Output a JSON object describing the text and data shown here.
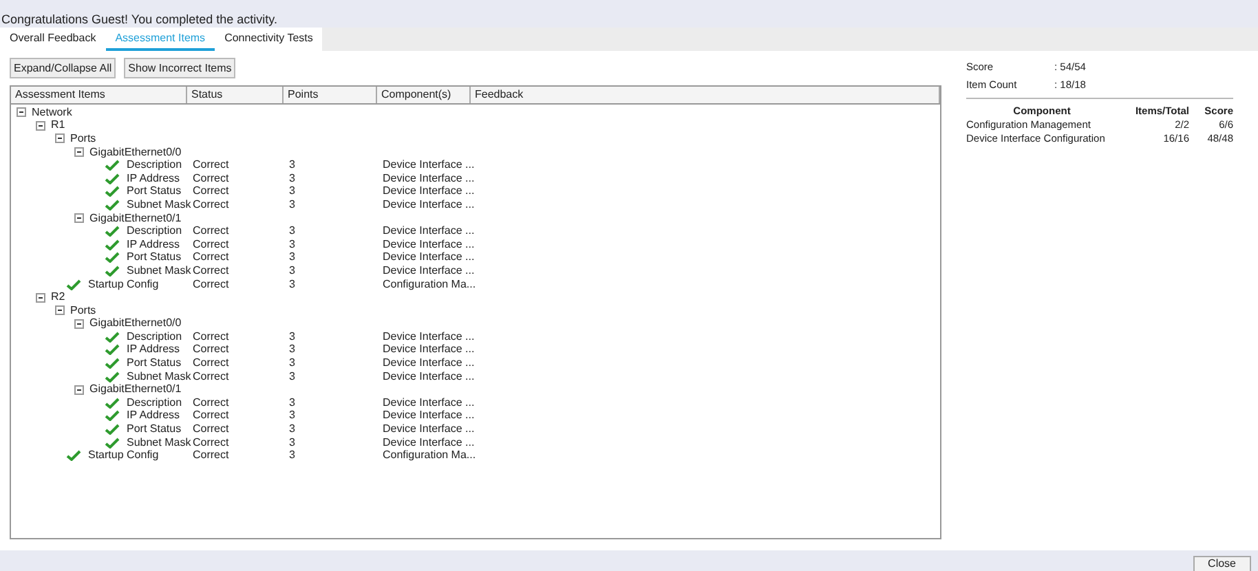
{
  "banner": "Congratulations Guest! You completed the activity.",
  "tabs": [
    {
      "label": "Overall Feedback",
      "selected": false
    },
    {
      "label": "Assessment Items",
      "selected": true
    },
    {
      "label": "Connectivity Tests",
      "selected": false
    }
  ],
  "toolbar": [
    "Expand/Collapse All",
    "Show Incorrect Items"
  ],
  "table": {
    "columns": [
      "Assessment Items",
      "Status",
      "Points",
      "Component(s)",
      "Feedback"
    ],
    "tree": [
      {
        "kind": "group",
        "label": "Network",
        "expanded": true,
        "children": [
          {
            "kind": "group",
            "label": "R1",
            "expanded": true,
            "children": [
              {
                "kind": "group",
                "label": "Ports",
                "expanded": true,
                "children": [
                  {
                    "kind": "group",
                    "label": "GigabitEthernet0/0",
                    "expanded": true,
                    "children": [
                      {
                        "kind": "item",
                        "label": "Description",
                        "status": "Correct",
                        "points": "3",
                        "component": "Device Interface ..."
                      },
                      {
                        "kind": "item",
                        "label": "IP Address",
                        "status": "Correct",
                        "points": "3",
                        "component": "Device Interface ..."
                      },
                      {
                        "kind": "item",
                        "label": "Port Status",
                        "status": "Correct",
                        "points": "3",
                        "component": "Device Interface ..."
                      },
                      {
                        "kind": "item",
                        "label": "Subnet Mask",
                        "status": "Correct",
                        "points": "3",
                        "component": "Device Interface ..."
                      }
                    ]
                  },
                  {
                    "kind": "group",
                    "label": "GigabitEthernet0/1",
                    "expanded": true,
                    "children": [
                      {
                        "kind": "item",
                        "label": "Description",
                        "status": "Correct",
                        "points": "3",
                        "component": "Device Interface ..."
                      },
                      {
                        "kind": "item",
                        "label": "IP Address",
                        "status": "Correct",
                        "points": "3",
                        "component": "Device Interface ..."
                      },
                      {
                        "kind": "item",
                        "label": "Port Status",
                        "status": "Correct",
                        "points": "3",
                        "component": "Device Interface ..."
                      },
                      {
                        "kind": "item",
                        "label": "Subnet Mask",
                        "status": "Correct",
                        "points": "3",
                        "component": "Device Interface ..."
                      }
                    ]
                  }
                ]
              },
              {
                "kind": "item",
                "label": "Startup Config",
                "status": "Correct",
                "points": "3",
                "component": "Configuration Ma..."
              }
            ]
          },
          {
            "kind": "group",
            "label": "R2",
            "expanded": true,
            "children": [
              {
                "kind": "group",
                "label": "Ports",
                "expanded": true,
                "children": [
                  {
                    "kind": "group",
                    "label": "GigabitEthernet0/0",
                    "expanded": true,
                    "children": [
                      {
                        "kind": "item",
                        "label": "Description",
                        "status": "Correct",
                        "points": "3",
                        "component": "Device Interface ..."
                      },
                      {
                        "kind": "item",
                        "label": "IP Address",
                        "status": "Correct",
                        "points": "3",
                        "component": "Device Interface ..."
                      },
                      {
                        "kind": "item",
                        "label": "Port Status",
                        "status": "Correct",
                        "points": "3",
                        "component": "Device Interface ..."
                      },
                      {
                        "kind": "item",
                        "label": "Subnet Mask",
                        "status": "Correct",
                        "points": "3",
                        "component": "Device Interface ..."
                      }
                    ]
                  },
                  {
                    "kind": "group",
                    "label": "GigabitEthernet0/1",
                    "expanded": true,
                    "children": [
                      {
                        "kind": "item",
                        "label": "Description",
                        "status": "Correct",
                        "points": "3",
                        "component": "Device Interface ..."
                      },
                      {
                        "kind": "item",
                        "label": "IP Address",
                        "status": "Correct",
                        "points": "3",
                        "component": "Device Interface ..."
                      },
                      {
                        "kind": "item",
                        "label": "Port Status",
                        "status": "Correct",
                        "points": "3",
                        "component": "Device Interface ..."
                      },
                      {
                        "kind": "item",
                        "label": "Subnet Mask",
                        "status": "Correct",
                        "points": "3",
                        "component": "Device Interface ..."
                      }
                    ]
                  }
                ]
              },
              {
                "kind": "item",
                "label": "Startup Config",
                "status": "Correct",
                "points": "3",
                "component": "Configuration Ma..."
              }
            ]
          }
        ]
      }
    ]
  },
  "summary": {
    "stats": [
      {
        "label": "Score",
        "value": ": 54/54"
      },
      {
        "label": "Item Count",
        "value": ": 18/18"
      }
    ],
    "columns": [
      "Component",
      "Items/Total",
      "Score"
    ],
    "rows": [
      [
        "Configuration Management",
        "2/2",
        "6/6"
      ],
      [
        "Device Interface Configuration",
        "16/16",
        "48/48"
      ]
    ]
  },
  "close_button": "Close"
}
